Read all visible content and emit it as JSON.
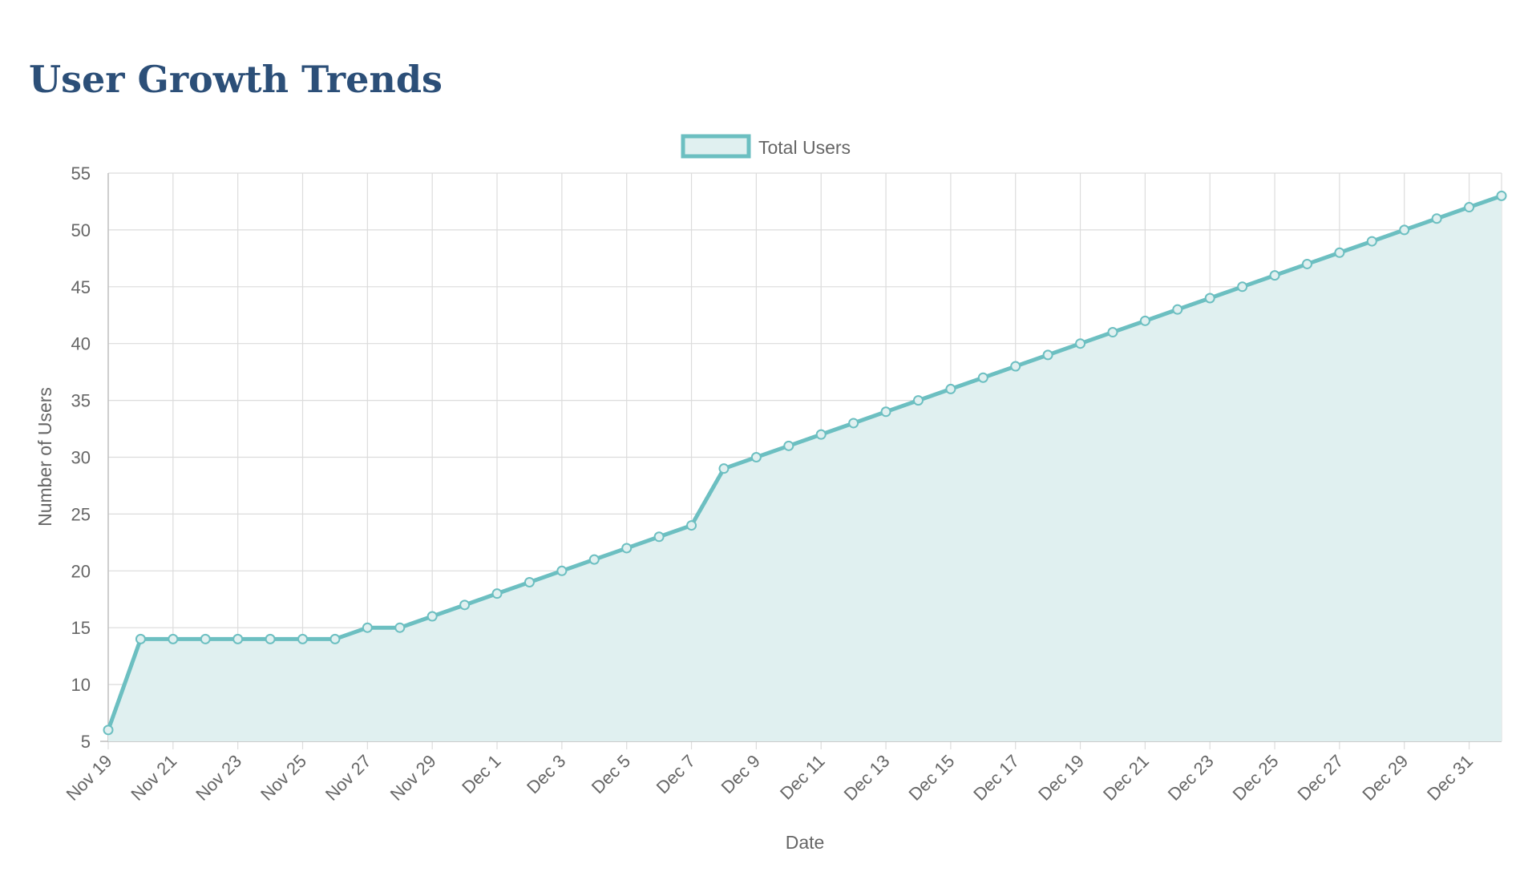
{
  "page": {
    "title": "User Growth Trends"
  },
  "colors": {
    "title": "#2c4f78",
    "line": "#6cbfc1",
    "fill": "#e0f0f0",
    "grid": "#dcdcdc",
    "text": "#666666"
  },
  "chart_data": {
    "type": "line",
    "title": "User Growth Trends",
    "xlabel": "Date",
    "ylabel": "Number of Users",
    "ylim": [
      5,
      55
    ],
    "y_ticks": [
      5,
      10,
      15,
      20,
      25,
      30,
      35,
      40,
      45,
      50,
      55
    ],
    "grid": true,
    "legend_position": "top-center",
    "fill": true,
    "x": [
      "Nov 19",
      "Nov 20",
      "Nov 21",
      "Nov 22",
      "Nov 23",
      "Nov 24",
      "Nov 25",
      "Nov 26",
      "Nov 27",
      "Nov 28",
      "Nov 29",
      "Nov 30",
      "Dec 1",
      "Dec 2",
      "Dec 3",
      "Dec 4",
      "Dec 5",
      "Dec 6",
      "Dec 7",
      "Dec 8",
      "Dec 9",
      "Dec 10",
      "Dec 11",
      "Dec 12",
      "Dec 13",
      "Dec 14",
      "Dec 15",
      "Dec 16",
      "Dec 17",
      "Dec 18",
      "Dec 19",
      "Dec 20",
      "Dec 21",
      "Dec 22",
      "Dec 23",
      "Dec 24",
      "Dec 25",
      "Dec 26",
      "Dec 27",
      "Dec 28",
      "Dec 29",
      "Dec 30",
      "Dec 31",
      "Jan 1"
    ],
    "x_tick_labels": [
      "Nov 19",
      "Nov 21",
      "Nov 23",
      "Nov 25",
      "Nov 27",
      "Nov 29",
      "Dec 1",
      "Dec 3",
      "Dec 5",
      "Dec 7",
      "Dec 9",
      "Dec 11",
      "Dec 13",
      "Dec 15",
      "Dec 17",
      "Dec 19",
      "Dec 21",
      "Dec 23",
      "Dec 25",
      "Dec 27",
      "Dec 29",
      "Dec 31"
    ],
    "series": [
      {
        "name": "Total Users",
        "values": [
          6,
          14,
          14,
          14,
          14,
          14,
          14,
          14,
          15,
          15,
          16,
          17,
          18,
          19,
          20,
          21,
          22,
          23,
          24,
          29,
          30,
          31,
          32,
          33,
          34,
          35,
          36,
          37,
          38,
          39,
          40,
          41,
          42,
          43,
          44,
          45,
          46,
          47,
          48,
          49,
          50,
          51,
          52,
          53
        ]
      }
    ]
  }
}
